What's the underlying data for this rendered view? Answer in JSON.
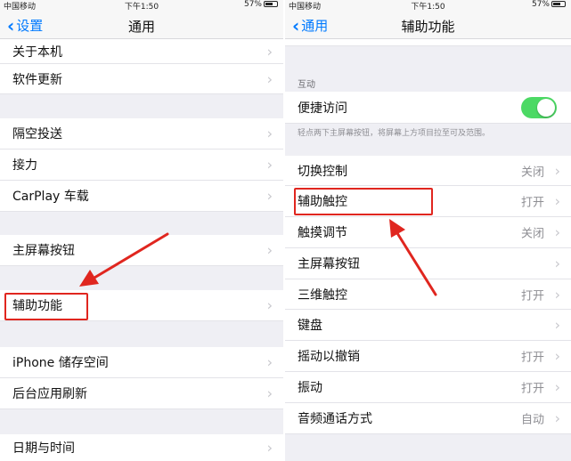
{
  "status_bar": {
    "carrier": "中国移动",
    "time": "下午1:50",
    "battery": "57%"
  },
  "left_screen": {
    "back_label": "设置",
    "title": "通用",
    "items": [
      {
        "label": "关于本机"
      },
      {
        "label": "软件更新"
      },
      {
        "label": "隔空投送"
      },
      {
        "label": "接力"
      },
      {
        "label": "CarPlay 车载"
      },
      {
        "label": "主屏幕按钮"
      },
      {
        "label": "辅助功能"
      },
      {
        "label": "iPhone 储存空间"
      },
      {
        "label": "后台应用刷新"
      },
      {
        "label": "日期与时间"
      }
    ]
  },
  "right_screen": {
    "back_label": "通用",
    "title": "辅助功能",
    "section_header": "互动",
    "toggle_item": {
      "label": "便捷访问",
      "state": "on"
    },
    "footnote": "轻点两下主屏幕按钮，将屏幕上方项目拉至可及范围。",
    "items": [
      {
        "label": "切换控制",
        "value": "关闭"
      },
      {
        "label": "辅助触控",
        "value": "打开"
      },
      {
        "label": "触摸调节",
        "value": "关闭"
      },
      {
        "label": "主屏幕按钮",
        "value": ""
      },
      {
        "label": "三维触控",
        "value": "打开"
      },
      {
        "label": "键盘",
        "value": ""
      },
      {
        "label": "摇动以撤销",
        "value": "打开"
      },
      {
        "label": "振动",
        "value": "打开"
      },
      {
        "label": "音频通话方式",
        "value": "自动"
      }
    ]
  },
  "colors": {
    "ios_blue": "#007aff",
    "toggle_green": "#4cd964",
    "annotation_red": "#e0261f"
  }
}
